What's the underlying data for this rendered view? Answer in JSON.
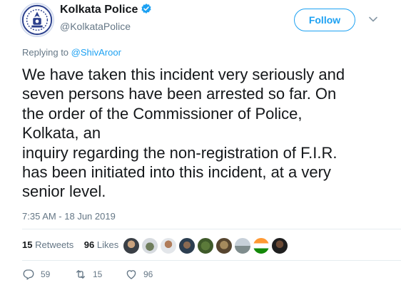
{
  "account": {
    "name": "Kolkata Police",
    "handle": "@KolkataPolice",
    "follow_label": "Follow"
  },
  "reply": {
    "prefix": "Replying to",
    "handle": "@ShivAroor"
  },
  "tweet": {
    "lines": [
      "We have taken this incident very seriously and",
      "seven persons have been arrested so far. On",
      "the order of the Commissioner of Police,",
      "Kolkata, an",
      "inquiry regarding the non-registration of F.I.R.",
      "has been initiated into this incident, at a very",
      "senior level."
    ],
    "timestamp": "7:35 AM - 18 Jun 2019"
  },
  "stats": {
    "retweets_count": "15",
    "retweets_label": "Retweets",
    "likes_count": "96",
    "likes_label": "Likes"
  },
  "actions": {
    "reply_count": "59",
    "retweet_count": "15",
    "like_count": "96"
  },
  "colors": {
    "accent": "#1da1f2",
    "secondary_text": "#657786",
    "divider": "#e6ecf0"
  },
  "icons": [
    "police-emblem-icon",
    "verified-badge-icon",
    "chevron-down-icon",
    "reply-icon",
    "retweet-icon",
    "like-icon"
  ]
}
